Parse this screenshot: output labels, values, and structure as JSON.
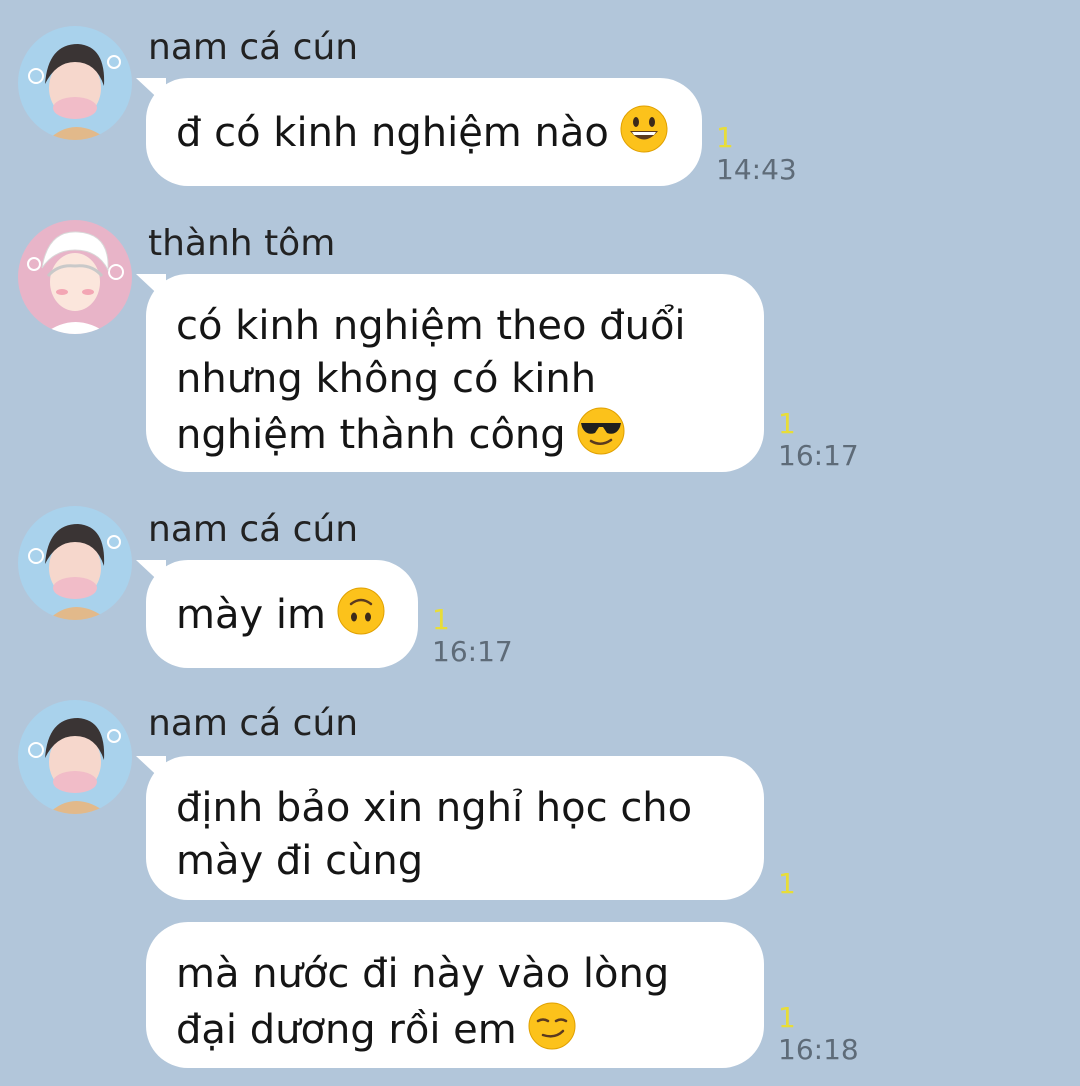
{
  "messages": [
    {
      "sender": "nam cá cún",
      "lines": [
        "đ có kinh nghiệm nào"
      ],
      "emoji": "grinning-face-emoji",
      "unread": "1",
      "time": "14:43"
    },
    {
      "sender": "thành tôm",
      "lines": [
        "có kinh nghiệm theo đuổi",
        "nhưng không có kinh",
        "nghiệm thành công"
      ],
      "emoji": "sunglasses-face-emoji",
      "unread": "1",
      "time": "16:17"
    },
    {
      "sender": "nam cá cún",
      "lines": [
        "mày im"
      ],
      "emoji": "upside-down-face-emoji",
      "unread": "1",
      "time": "16:17"
    },
    {
      "sender": "nam cá cún",
      "lines": [
        "định bảo xin nghỉ học cho",
        "mày đi cùng"
      ],
      "unread": "1"
    },
    {
      "lines": [
        "mà nước đi này vào lòng",
        "đại dương rồi em"
      ],
      "emoji": "smirking-face-emoji",
      "unread": "1",
      "time": "16:18"
    }
  ],
  "colors": {
    "background": "#b2c6da",
    "bubble": "#ffffff",
    "unread": "#e8dd38",
    "time": "#5e6b78"
  }
}
